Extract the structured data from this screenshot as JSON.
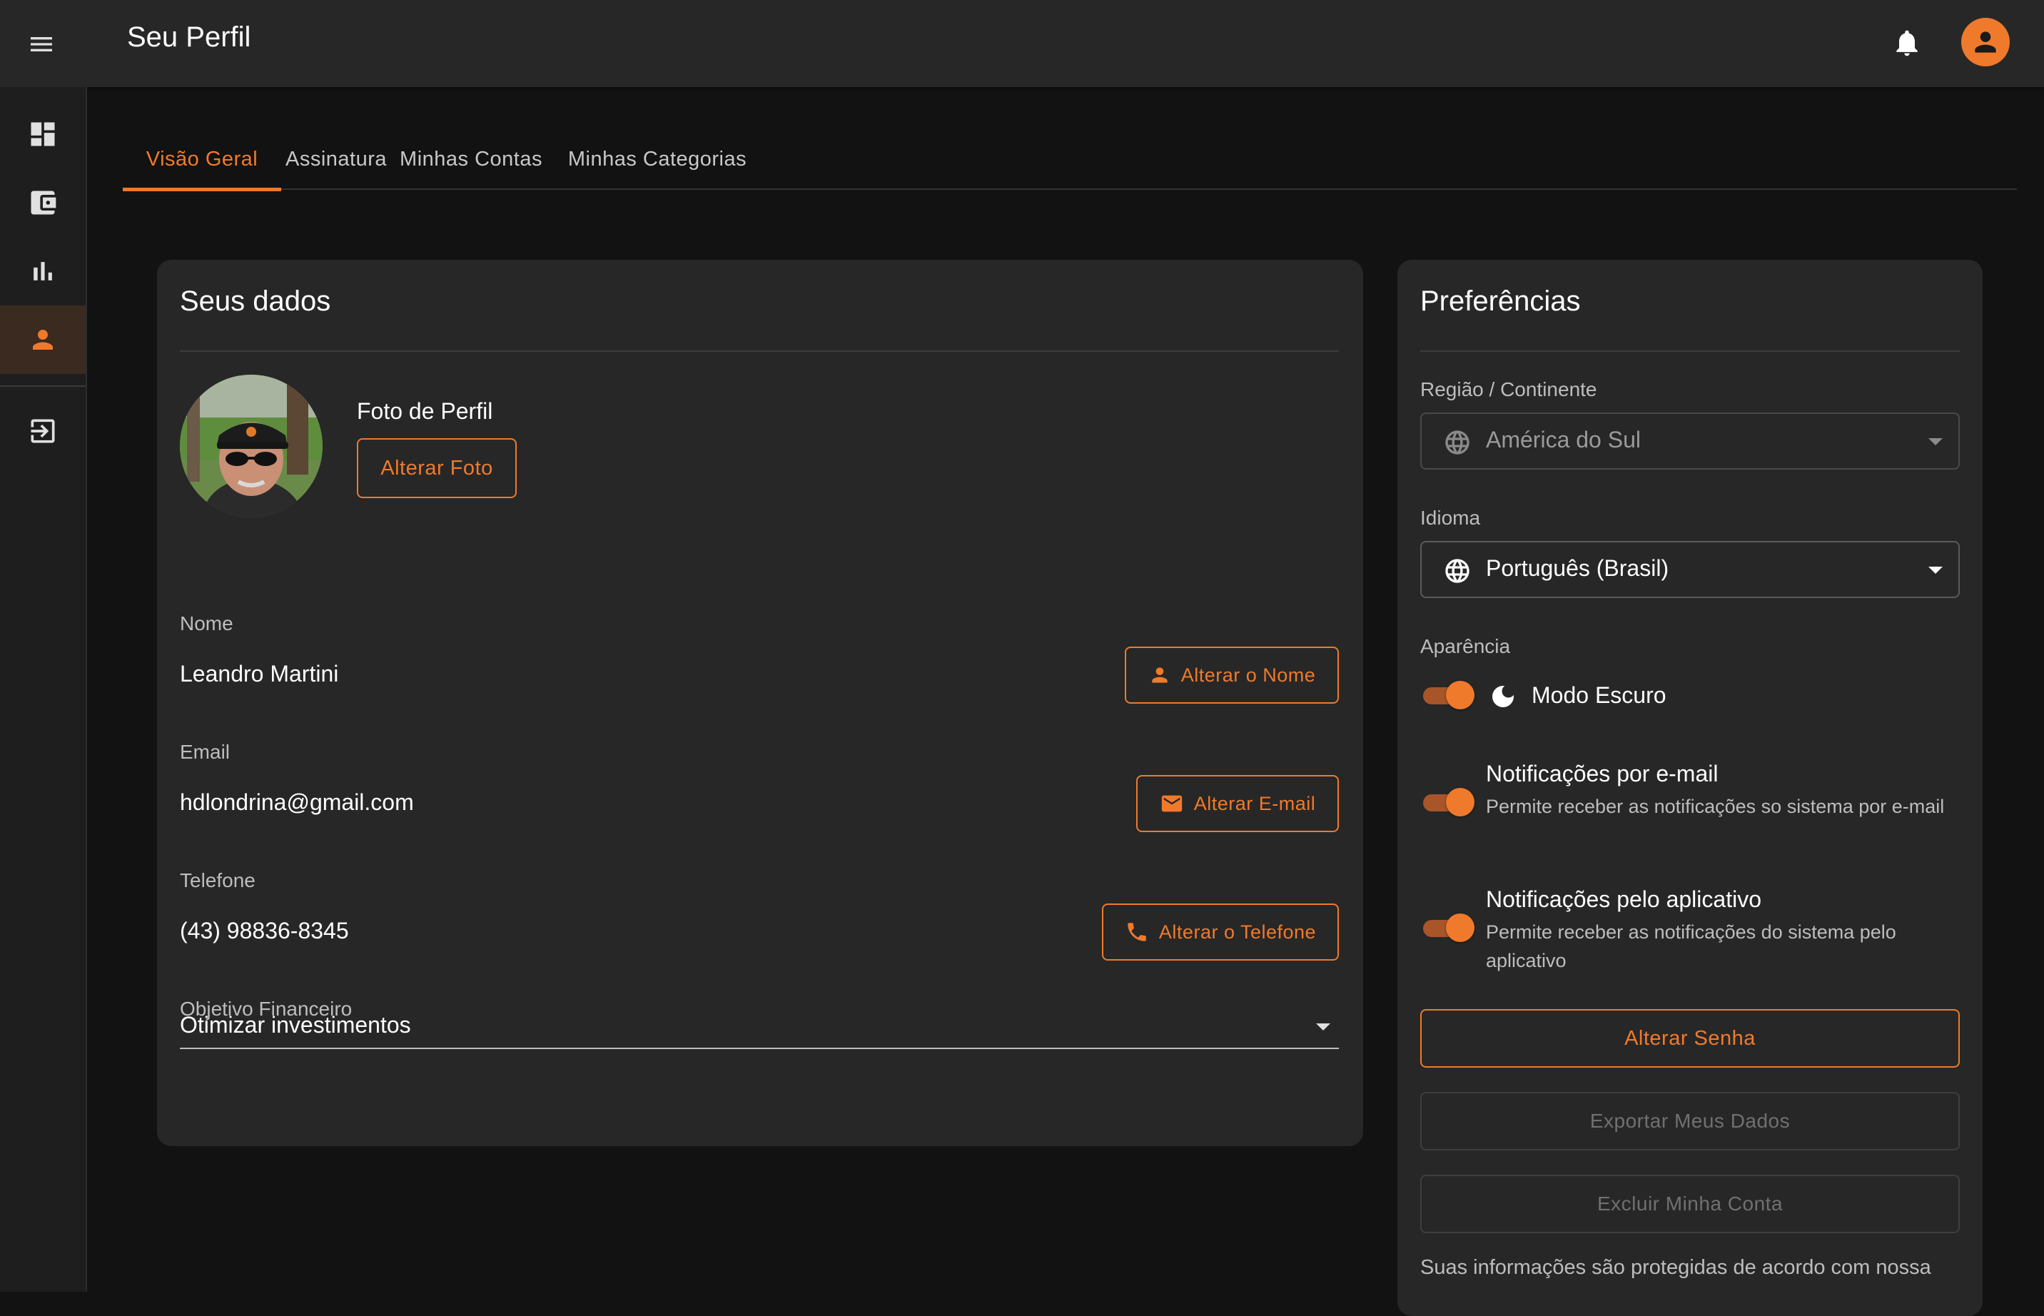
{
  "app": {
    "title": "Seu Perfil",
    "accent_color": "#f07a2b",
    "background_color": "#121212",
    "surface_color": "#272727"
  },
  "topbar": {
    "menu_icon": "menu-icon",
    "notification_icon": "bell-icon",
    "account_icon": "account-circle-icon"
  },
  "sidebar": {
    "items": [
      {
        "name": "dashboard",
        "icon": "dashboard-icon",
        "active": false
      },
      {
        "name": "wallet",
        "icon": "wallet-icon",
        "active": false
      },
      {
        "name": "reports",
        "icon": "bar-chart-icon",
        "active": false
      },
      {
        "name": "profile",
        "icon": "person-icon",
        "active": true
      },
      {
        "name": "logout",
        "icon": "logout-icon",
        "active": false
      }
    ]
  },
  "tabs": [
    {
      "label": "Visão Geral",
      "active": true
    },
    {
      "label": "Assinatura",
      "active": false
    },
    {
      "label": "Minhas Contas",
      "active": false
    },
    {
      "label": "Minhas Categorias",
      "active": false
    }
  ],
  "profile_card": {
    "title": "Seus dados",
    "photo_label": "Foto de Perfil",
    "change_photo_button": "Alterar Foto",
    "name_label": "Nome",
    "name_value": "Leandro Martini",
    "change_name_button": "Alterar o Nome",
    "email_label": "Email",
    "email_value": "hdlondrina@gmail.com",
    "change_email_button": "Alterar E-mail",
    "phone_label": "Telefone",
    "phone_value": "(43) 98836-8345",
    "change_phone_button": "Alterar o Telefone",
    "goal_label": "Objetivo Financeiro",
    "goal_value": "Otimizar investimentos"
  },
  "preferences_card": {
    "title": "Preferências",
    "region_label": "Região / Continente",
    "region_value": "América do Sul",
    "language_label": "Idioma",
    "language_value": "Português (Brasil)",
    "appearance_label": "Aparência",
    "dark_mode_label": "Modo Escuro",
    "dark_mode_on": true,
    "email_notifications_title": "Notificações por e-mail",
    "email_notifications_desc": "Permite receber as notificações so sistema por e-mail",
    "email_notifications_on": true,
    "app_notifications_title": "Notificações pelo aplicativo",
    "app_notifications_desc": "Permite receber as notificações do sistema pelo aplicativo",
    "app_notifications_on": true,
    "change_password_button": "Alterar Senha",
    "export_data_button": "Exportar Meus Dados",
    "delete_account_button": "Excluir Minha Conta",
    "footer_text": "Suas informações são protegidas de acordo com nossa"
  }
}
